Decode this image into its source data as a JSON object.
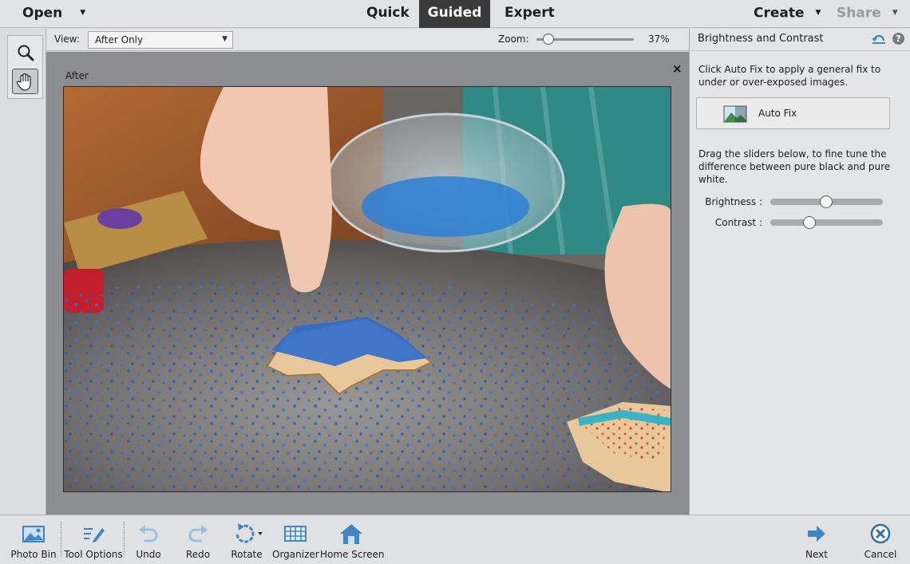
{
  "topbar": {
    "open": "Open",
    "modes": [
      "Quick",
      "Guided",
      "Expert"
    ],
    "active_mode": "Guided",
    "create": "Create",
    "share": "Share"
  },
  "tools": [
    {
      "name": "zoom-tool",
      "icon": "magnifier-icon"
    },
    {
      "name": "hand-tool",
      "icon": "hand-icon"
    }
  ],
  "options": {
    "view_label": "View:",
    "view_value": "After Only",
    "zoom_label": "Zoom:",
    "zoom_value": "37%",
    "zoom_level": 0.37
  },
  "canvas": {
    "after_label": "After",
    "close": "×"
  },
  "panel": {
    "title": "Brightness and Contrast",
    "help": "?",
    "intro": "Click Auto Fix to apply a general fix to under or over-exposed images.",
    "auto_fix": "Auto Fix",
    "drag_text": "Drag the sliders below, to fine tune the difference between pure black and pure white.",
    "brightness_label": "Brightness :",
    "contrast_label": "Contrast :",
    "brightness_level": 0.5,
    "contrast_level": 0.35
  },
  "bottombar": {
    "photo_bin": "Photo Bin",
    "tool_options": "Tool Options",
    "undo": "Undo",
    "redo": "Redo",
    "rotate": "Rotate",
    "organizer": "Organizer",
    "home_screen": "Home Screen",
    "next": "Next",
    "cancel": "Cancel"
  },
  "colors": {
    "accent_blue": "#3f86c9",
    "active_tab": "#3a3a3a",
    "cancel_blue": "#2f6fb0"
  }
}
